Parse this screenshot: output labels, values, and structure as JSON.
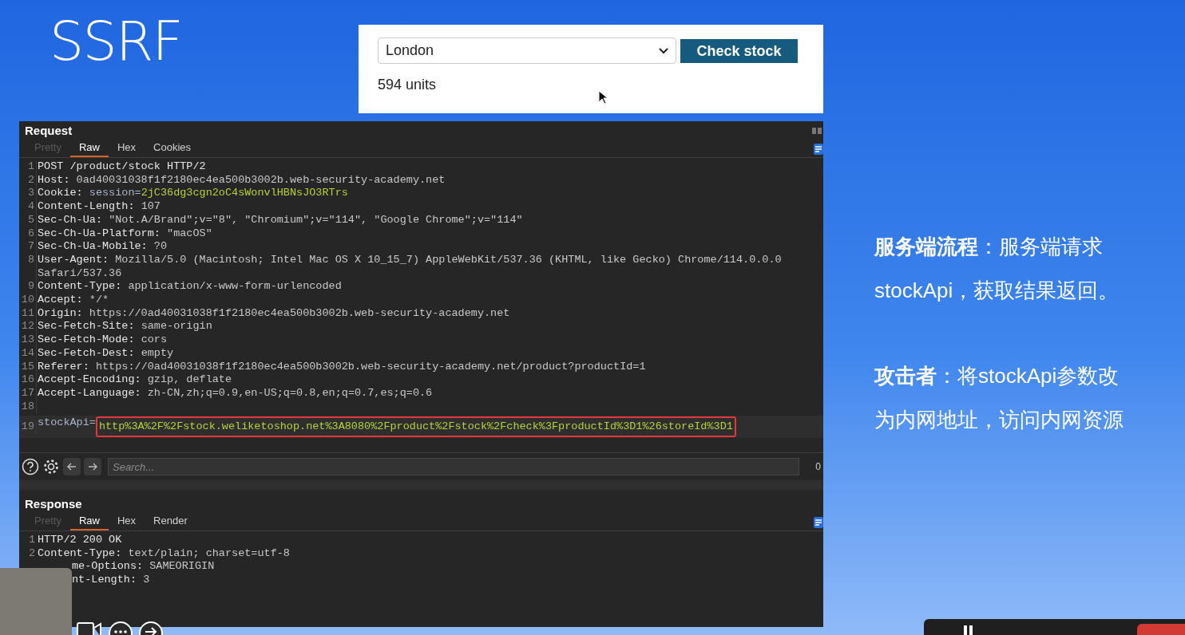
{
  "slide_title": "SSRF",
  "stock_widget": {
    "location": "London",
    "button": "Check stock",
    "result": "594 units"
  },
  "request": {
    "title": "Request",
    "tabs": [
      {
        "label": "Pretty",
        "selected": false,
        "disabled": true
      },
      {
        "label": "Raw",
        "selected": true,
        "disabled": false
      },
      {
        "label": "Hex",
        "selected": false,
        "disabled": false
      },
      {
        "label": "Cookies",
        "selected": false,
        "disabled": false
      }
    ],
    "lines": [
      {
        "number": "1",
        "selected": false,
        "parts": [
          {
            "kind": "name",
            "text": "POST /product/stock HTTP/2"
          }
        ]
      },
      {
        "number": "2",
        "selected": false,
        "parts": [
          {
            "kind": "name",
            "text": "Host: "
          },
          {
            "kind": "value",
            "text": "0ad40031038f1f2180ec4ea500b3002b.web-security-academy.net"
          }
        ]
      },
      {
        "number": "3",
        "selected": false,
        "parts": [
          {
            "kind": "name",
            "text": "Cookie: "
          },
          {
            "kind": "param_name",
            "text": "session="
          },
          {
            "kind": "param_value",
            "text": "2jC36dg3cgn2oC4sWonvlHBNsJO3RTrs"
          }
        ]
      },
      {
        "number": "4",
        "selected": false,
        "parts": [
          {
            "kind": "name",
            "text": "Content-Length: "
          },
          {
            "kind": "value",
            "text": "107"
          }
        ]
      },
      {
        "number": "5",
        "selected": false,
        "parts": [
          {
            "kind": "name",
            "text": "Sec-Ch-Ua: "
          },
          {
            "kind": "value",
            "text": "\"Not.A/Brand\";v=\"8\", \"Chromium\";v=\"114\", \"Google Chrome\";v=\"114\""
          }
        ]
      },
      {
        "number": "6",
        "selected": false,
        "parts": [
          {
            "kind": "name",
            "text": "Sec-Ch-Ua-Platform: "
          },
          {
            "kind": "value",
            "text": "\"macOS\""
          }
        ]
      },
      {
        "number": "7",
        "selected": false,
        "parts": [
          {
            "kind": "name",
            "text": "Sec-Ch-Ua-Mobile: "
          },
          {
            "kind": "value",
            "text": "?0"
          }
        ]
      },
      {
        "number": "8",
        "selected": false,
        "parts": [
          {
            "kind": "name",
            "text": "User-Agent: "
          },
          {
            "kind": "value",
            "text": "Mozilla/5.0 (Macintosh; Intel Mac OS X 10_15_7) AppleWebKit/537.36 (KHTML, like Gecko) Chrome/114.0.0.0"
          }
        ],
        "continuation": "Safari/537.36"
      },
      {
        "number": "9",
        "selected": false,
        "parts": [
          {
            "kind": "name",
            "text": "Content-Type: "
          },
          {
            "kind": "value",
            "text": "application/x-www-form-urlencoded"
          }
        ]
      },
      {
        "number": "10",
        "selected": false,
        "parts": [
          {
            "kind": "name",
            "text": "Accept: "
          },
          {
            "kind": "value",
            "text": "*/*"
          }
        ]
      },
      {
        "number": "11",
        "selected": false,
        "parts": [
          {
            "kind": "name",
            "text": "Origin: "
          },
          {
            "kind": "value",
            "text": "https://0ad40031038f1f2180ec4ea500b3002b.web-security-academy.net"
          }
        ]
      },
      {
        "number": "12",
        "selected": false,
        "parts": [
          {
            "kind": "name",
            "text": "Sec-Fetch-Site: "
          },
          {
            "kind": "value",
            "text": "same-origin"
          }
        ]
      },
      {
        "number": "13",
        "selected": false,
        "parts": [
          {
            "kind": "name",
            "text": "Sec-Fetch-Mode: "
          },
          {
            "kind": "value",
            "text": "cors"
          }
        ]
      },
      {
        "number": "14",
        "selected": false,
        "parts": [
          {
            "kind": "name",
            "text": "Sec-Fetch-Dest: "
          },
          {
            "kind": "value",
            "text": "empty"
          }
        ]
      },
      {
        "number": "15",
        "selected": false,
        "parts": [
          {
            "kind": "name",
            "text": "Referer: "
          },
          {
            "kind": "value",
            "text": "https://0ad40031038f1f2180ec4ea500b3002b.web-security-academy.net/product?productId=1"
          }
        ]
      },
      {
        "number": "16",
        "selected": false,
        "parts": [
          {
            "kind": "name",
            "text": "Accept-Encoding: "
          },
          {
            "kind": "value",
            "text": "gzip, deflate"
          }
        ]
      },
      {
        "number": "17",
        "selected": false,
        "parts": [
          {
            "kind": "name",
            "text": "Accept-Language: "
          },
          {
            "kind": "value",
            "text": "zh-CN,zh;q=0.9,en-US;q=0.8,en;q=0.7,es;q=0.6"
          }
        ]
      },
      {
        "number": "18",
        "selected": false
      },
      {
        "number": "19",
        "selected": true,
        "parts": [
          {
            "kind": "param_name",
            "text": "stockApi="
          },
          {
            "kind": "boxed_value",
            "text": "http%3A%2F%2Fstock.weliketoshop.net%3A8080%2Fproduct%2Fstock%2Fcheck%3FproductId%3D1%26storeId%3D1"
          }
        ]
      }
    ],
    "search": {
      "placeholder": "Search...",
      "count": "0"
    }
  },
  "response": {
    "title": "Response",
    "tabs": [
      {
        "label": "Pretty",
        "selected": false,
        "disabled": true
      },
      {
        "label": "Raw",
        "selected": true,
        "disabled": false
      },
      {
        "label": "Hex",
        "selected": false,
        "disabled": false
      },
      {
        "label": "Render",
        "selected": false,
        "disabled": false
      }
    ],
    "lines": [
      {
        "number": "1",
        "parts": [
          {
            "kind": "name",
            "text": "HTTP/2 200 OK"
          }
        ]
      },
      {
        "number": "2",
        "parts": [
          {
            "kind": "name",
            "text": "Content-Type: "
          },
          {
            "kind": "value",
            "text": "text/plain; charset=utf-8"
          }
        ]
      },
      {
        "kind": "covered",
        "parts": [
          {
            "kind": "name",
            "text": "me-Options: "
          },
          {
            "kind": "value",
            "text": "SAMEORIGIN"
          }
        ]
      },
      {
        "kind": "covered",
        "parts": [
          {
            "kind": "name",
            "text": "nt-Length: "
          },
          {
            "kind": "value",
            "text": "3"
          }
        ]
      }
    ]
  },
  "notes": [
    {
      "term": "服务端流程",
      "separator": "：",
      "lines": [
        "服务端请求",
        "stockApi，获取结果返回。"
      ]
    },
    {
      "term": "攻击者",
      "separator": "：",
      "lines": [
        "将stockApi参数改",
        "为内网地址，访问内网资源"
      ]
    }
  ]
}
